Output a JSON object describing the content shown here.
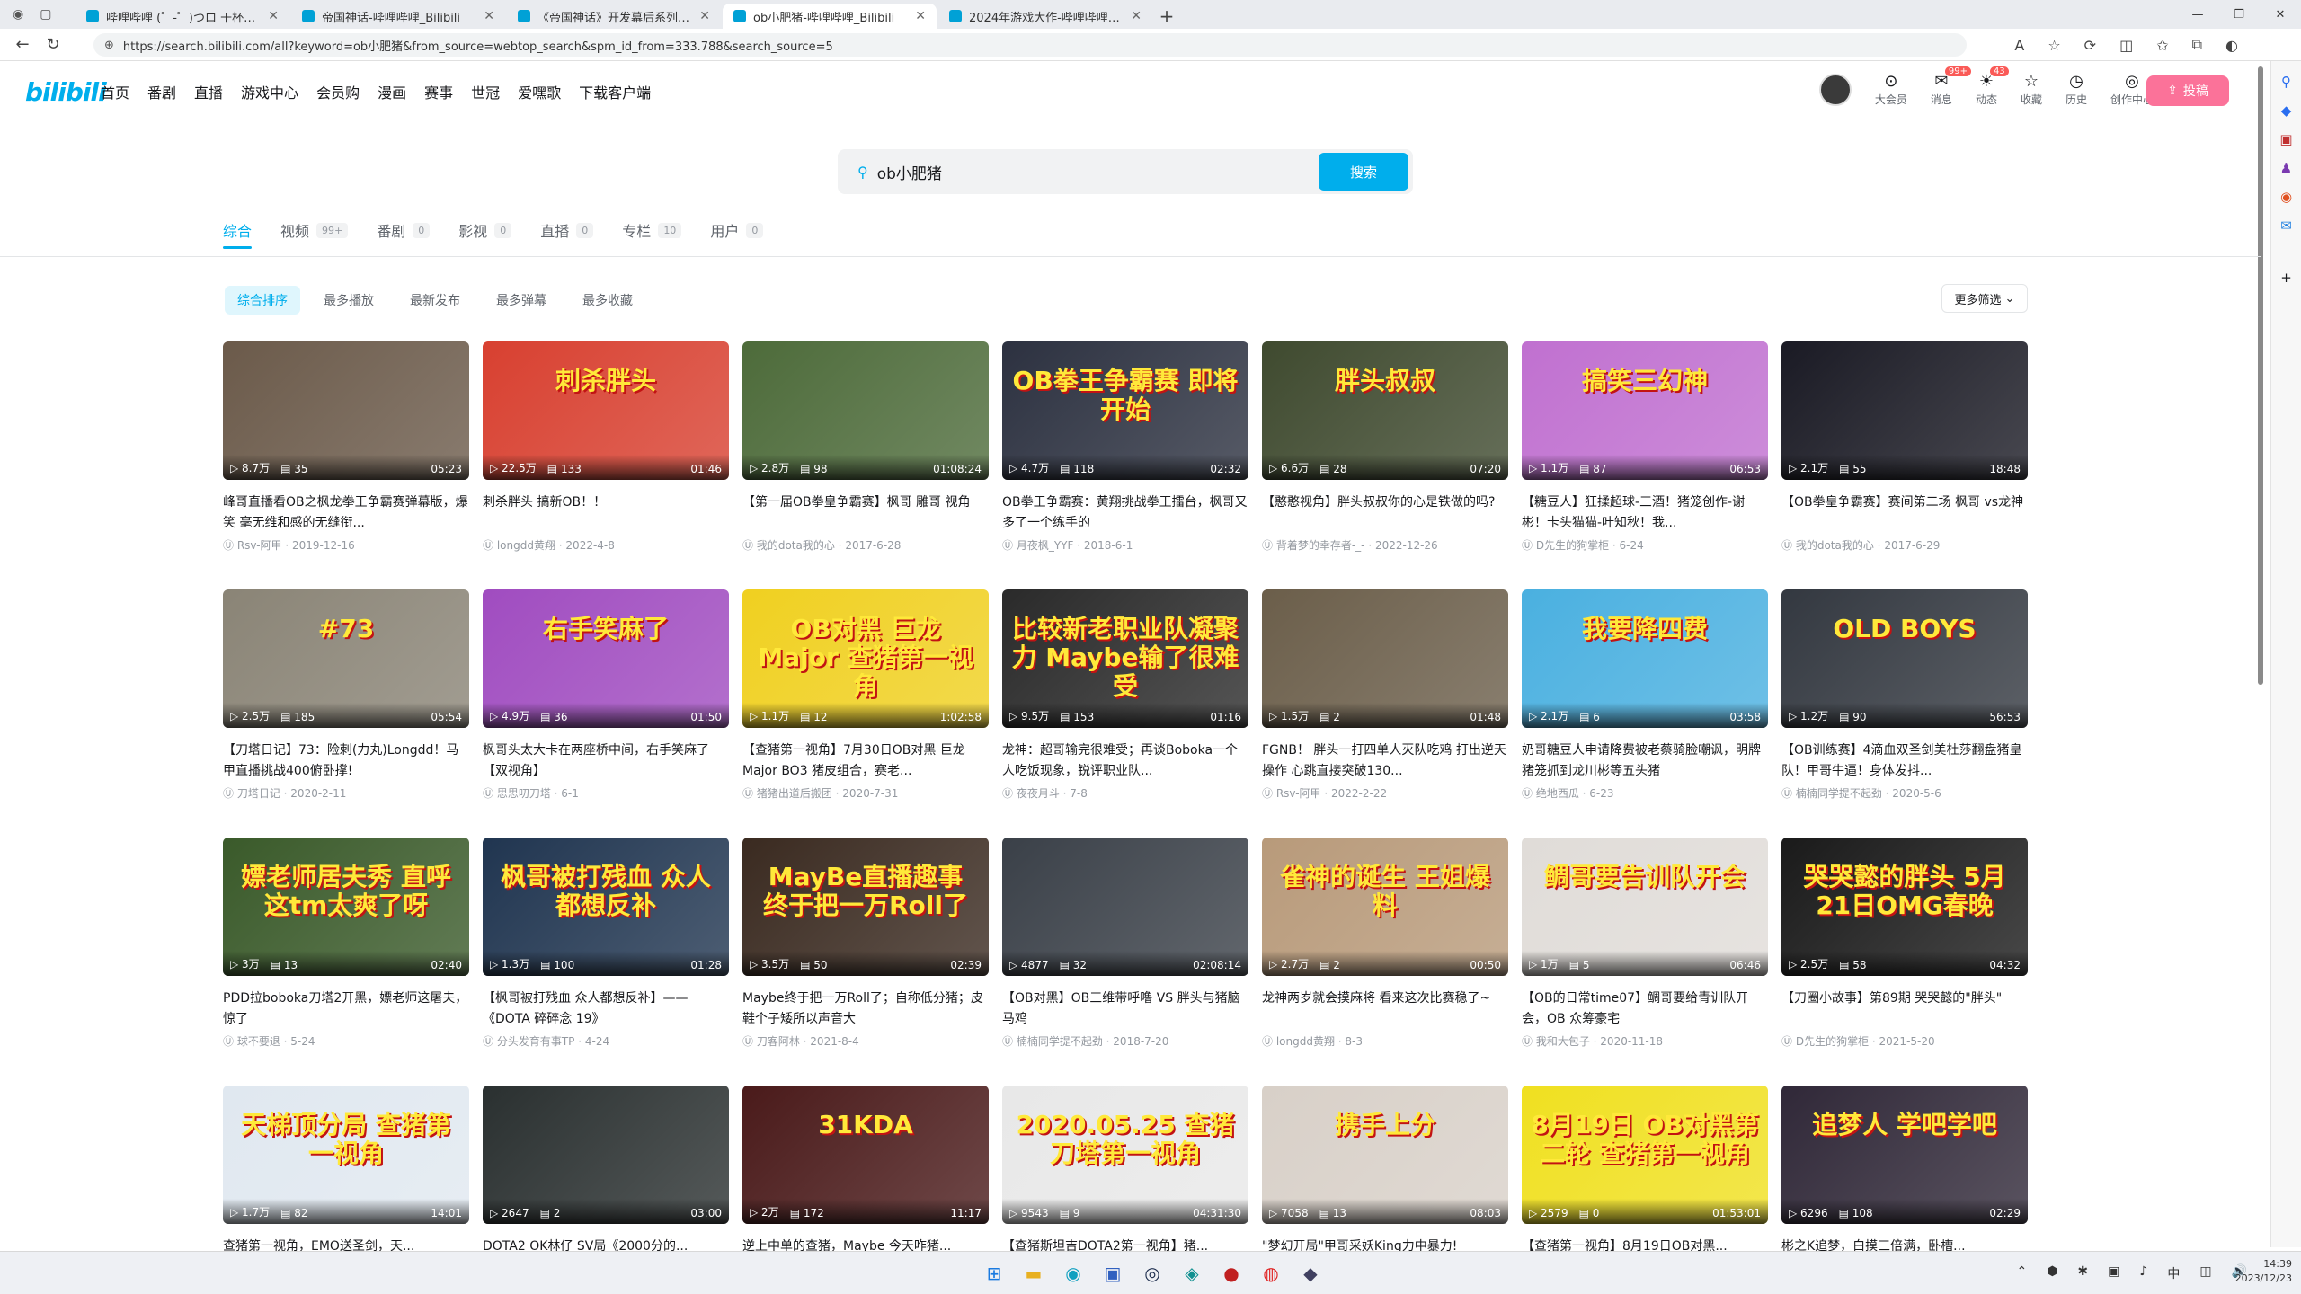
{
  "browser": {
    "tabs": [
      {
        "title": "哔哩哔哩 (゜-゜)つロ 干杯~-bilibili",
        "active": false
      },
      {
        "title": "帝国神话-哔哩哔哩_Bilibili",
        "active": false
      },
      {
        "title": "《帝国神话》开发幕后系列纪录...",
        "active": false
      },
      {
        "title": "ob小肥猪-哔哩哔哩_Bilibili",
        "active": true
      },
      {
        "title": "2024年游戏大作-哔哩哔哩_Bilibili",
        "active": false
      }
    ],
    "url": "https://search.bilibili.com/all?keyword=ob小肥猪&from_source=webtop_search&spm_id_from=333.788&search_source=5"
  },
  "header": {
    "logo": "bilibili",
    "nav": [
      "首页",
      "番剧",
      "直播",
      "游戏中心",
      "会员购",
      "漫画",
      "赛事",
      "世冠",
      "爱嘿歌",
      "下载客户端"
    ],
    "icons": [
      {
        "label": "大会员",
        "icon": "⊙"
      },
      {
        "label": "消息",
        "icon": "✉",
        "badge": "99+"
      },
      {
        "label": "动态",
        "icon": "☀",
        "badge": "43"
      },
      {
        "label": "收藏",
        "icon": "☆"
      },
      {
        "label": "历史",
        "icon": "◷"
      },
      {
        "label": "创作中心",
        "icon": "◎"
      }
    ],
    "upload": "投稿"
  },
  "search": {
    "query": "ob小肥猪",
    "button": "搜索"
  },
  "tabs": [
    {
      "label": "综合",
      "count": ""
    },
    {
      "label": "视频",
      "count": "99+"
    },
    {
      "label": "番剧",
      "count": "0"
    },
    {
      "label": "影视",
      "count": "0"
    },
    {
      "label": "直播",
      "count": "0"
    },
    {
      "label": "专栏",
      "count": "10"
    },
    {
      "label": "用户",
      "count": "0"
    }
  ],
  "sorts": [
    "综合排序",
    "最多播放",
    "最新发布",
    "最多弹幕",
    "最多收藏"
  ],
  "filter": "更多筛选",
  "videos": [
    {
      "thumb_text": "",
      "bg": "#6b5a4a",
      "views": "8.7万",
      "danmaku": "35",
      "dur": "05:23",
      "title": "峰哥直播看OB之枫龙拳王争霸赛弹幕版，爆笑 毫无维和感的无缝衔...",
      "author": "Rsv-阿甲",
      "date": "2019-12-16"
    },
    {
      "thumb_text": "刺杀胖头",
      "bg": "#d84030",
      "views": "22.5万",
      "danmaku": "133",
      "dur": "01:46",
      "title": "刺杀胖头 搞新OB！！",
      "author": "longdd黄翔",
      "date": "2022-4-8"
    },
    {
      "thumb_text": "",
      "bg": "#4d6b3a",
      "views": "2.8万",
      "danmaku": "98",
      "dur": "01:08:24",
      "title": "【第一届OB拳皇争霸赛】枫哥 雕哥 视角",
      "author": "我的dota我的心",
      "date": "2017-6-28"
    },
    {
      "thumb_text": "OB拳王争霸赛 即将开始",
      "bg": "#2c3140",
      "views": "4.7万",
      "danmaku": "118",
      "dur": "02:32",
      "title": "OB拳王争霸赛：黄翔挑战拳王擂台，枫哥又多了一个练手的",
      "author": "月夜枫_YYF",
      "date": "2018-6-1"
    },
    {
      "thumb_text": "胖头叔叔",
      "bg": "#3f4a2f",
      "views": "6.6万",
      "danmaku": "28",
      "dur": "07:20",
      "title": "【憨憨视角】胖头叔叔你的心是铁做的吗?",
      "author": "背着梦的幸存者-_-",
      "date": "2022-12-26"
    },
    {
      "thumb_text": "搞笑三幻神",
      "bg": "#c070d0",
      "views": "1.1万",
      "danmaku": "87",
      "dur": "06:53",
      "title": "【糖豆人】狂揉超球-三酒！猪笼创作-谢彬！卡头猫猫-叶知秋！我...",
      "author": "D先生的狗掌柜",
      "date": "6-24"
    },
    {
      "thumb_text": "",
      "bg": "#1a1a24",
      "views": "2.1万",
      "danmaku": "55",
      "dur": "18:48",
      "title": "【OB拳皇争霸赛】赛间第二场 枫哥 vs龙神",
      "author": "我的dota我的心",
      "date": "2017-6-29"
    },
    {
      "thumb_text": "#73",
      "bg": "#8a8476",
      "views": "2.5万",
      "danmaku": "185",
      "dur": "05:54",
      "title": "【刀塔日记】73：险刺(力丸)Longdd！马甲直播挑战400俯卧撑!",
      "author": "刀塔日记",
      "date": "2020-2-11"
    },
    {
      "thumb_text": "右手笑麻了",
      "bg": "#a04cc0",
      "views": "4.9万",
      "danmaku": "36",
      "dur": "01:50",
      "title": "枫哥头太大卡在两座桥中间，右手笑麻了【双视角】",
      "author": "思思叨刀塔",
      "date": "6-1"
    },
    {
      "thumb_text": "OB对黑 巨龙Major 查猪第一视角",
      "bg": "#f0d020",
      "views": "1.1万",
      "danmaku": "12",
      "dur": "1:02:58",
      "title": "【查猪第一视角】7月30日OB对黑 巨龙Major BO3 猪皮组合，赛老...",
      "author": "猪猪出道后搬团",
      "date": "2020-7-31"
    },
    {
      "thumb_text": "比较新老职业队凝聚力 Maybe输了很难受",
      "bg": "#2a2a2a",
      "views": "9.5万",
      "danmaku": "153",
      "dur": "01:16",
      "title": "龙神：超哥输完很难受；再谈Boboka一个人吃饭现象，锐评职业队...",
      "author": "夜夜月斗",
      "date": "7-8"
    },
    {
      "thumb_text": "",
      "bg": "#6b5e4a",
      "views": "1.5万",
      "danmaku": "2",
      "dur": "01:48",
      "title": "FGNB！ 胖头一打四单人灭队吃鸡 打出逆天操作 心跳直接突破130...",
      "author": "Rsv-阿甲",
      "date": "2022-2-22"
    },
    {
      "thumb_text": "我要降四费",
      "bg": "#4ab0e0",
      "views": "2.1万",
      "danmaku": "6",
      "dur": "03:58",
      "title": "奶哥糖豆人申请降费被老蔡骑脸嘲讽，明牌猪笼抓到龙川彬等五头猪",
      "author": "绝地西瓜",
      "date": "6-23"
    },
    {
      "thumb_text": "OLD BOYS",
      "bg": "#333840",
      "views": "1.2万",
      "danmaku": "90",
      "dur": "56:53",
      "title": "【OB训练赛】4滴血双圣剑美杜莎翻盘猪皇队！甲哥牛逼！身体发抖...",
      "author": "楠楠同学提不起劲",
      "date": "2020-5-6"
    },
    {
      "thumb_text": "嫖老师居夫秀 直呼这tm太爽了呀",
      "bg": "#3a5a2a",
      "views": "3万",
      "danmaku": "13",
      "dur": "02:40",
      "title": "PDD拉boboka刀塔2开黑，嫖老师这屠夫，惊了",
      "author": "球不要退",
      "date": "5-24"
    },
    {
      "thumb_text": "枫哥被打残血 众人都想反补",
      "bg": "#203550",
      "views": "1.3万",
      "danmaku": "100",
      "dur": "01:28",
      "title": "【枫哥被打残血 众人都想反补】——《DOTA 碎碎念 19》",
      "author": "分头发育有事TP",
      "date": "4-24"
    },
    {
      "thumb_text": "MayBe直播趣事 终于把一万Roll了",
      "bg": "#3a2a20",
      "views": "3.5万",
      "danmaku": "50",
      "dur": "02:39",
      "title": "Maybe终于把一万Roll了；自称低分猪；皮鞋个子矮所以声音大",
      "author": "刀客阿林",
      "date": "2021-8-4"
    },
    {
      "thumb_text": "",
      "bg": "#3a4048",
      "views": "4877",
      "danmaku": "32",
      "dur": "02:08:14",
      "title": "【OB对黑】OB三维带呼噜 VS 胖头与猪脑马鸡",
      "author": "楠楠同学提不起劲",
      "date": "2018-7-20"
    },
    {
      "thumb_text": "雀神的诞生 王姐爆料",
      "bg": "#b89a7a",
      "views": "2.7万",
      "danmaku": "2",
      "dur": "00:50",
      "title": "龙神两岁就会摸麻将 看来这次比赛稳了~",
      "author": "longdd黄翔",
      "date": "8-3"
    },
    {
      "thumb_text": "鲷哥要告训队开会",
      "bg": "#e0dcd8",
      "views": "1万",
      "danmaku": "5",
      "dur": "06:46",
      "title": "【OB的日常time07】鲷哥要给青训队开会，OB 众筹豪宅",
      "author": "我和大包子",
      "date": "2020-11-18"
    },
    {
      "thumb_text": "哭哭懿的胖头 5月21日OMG春晚",
      "bg": "#1a1a1a",
      "views": "2.5万",
      "danmaku": "58",
      "dur": "04:32",
      "title": "【刀圈小故事】第89期 哭哭懿的\"胖头\"",
      "author": "D先生的狗掌柜",
      "date": "2021-5-20"
    },
    {
      "thumb_text": "天梯顶分局 查猪第一视角",
      "bg": "#e0e8f0",
      "views": "1.7万",
      "danmaku": "82",
      "dur": "14:01",
      "title": "查猪第一视角，EMO送圣剑，天...",
      "author": "",
      "date": ""
    },
    {
      "thumb_text": "",
      "bg": "#2a3030",
      "views": "2647",
      "danmaku": "2",
      "dur": "03:00",
      "title": "DOTA2 OK林仔 SV局《2000分的...",
      "author": "",
      "date": ""
    },
    {
      "thumb_text": "31KDA",
      "bg": "#4a1a1a",
      "views": "2万",
      "danmaku": "172",
      "dur": "11:17",
      "title": "逆上中单的查猪，Maybe 今天咋猪...",
      "author": "",
      "date": ""
    },
    {
      "thumb_text": "2020.05.25 查猪刀塔第一视角",
      "bg": "#e8e8e8",
      "views": "9543",
      "danmaku": "9",
      "dur": "04:31:30",
      "title": "【查猪斯坦吉DOTA2第一视角】猪...",
      "author": "",
      "date": ""
    },
    {
      "thumb_text": "携手上分",
      "bg": "#d8d0c8",
      "views": "7058",
      "danmaku": "13",
      "dur": "08:03",
      "title": "\"梦幻开局\"甲哥采妖King力中暴力!",
      "author": "",
      "date": ""
    },
    {
      "thumb_text": "8月19日 OB对黑第二轮 查猪第一视角",
      "bg": "#f0e020",
      "views": "2579",
      "danmaku": "0",
      "dur": "01:53:01",
      "title": "【查猪第一视角】8月19日OB对黑...",
      "author": "",
      "date": ""
    },
    {
      "thumb_text": "追梦人 学吧学吧",
      "bg": "#302838",
      "views": "6296",
      "danmaku": "108",
      "dur": "02:29",
      "title": "彬之K追梦，白摸三倍满，卧槽...",
      "author": "",
      "date": ""
    }
  ],
  "taskbar": {
    "time": "14:39",
    "date": "2023/12/23",
    "tray": [
      "⌃",
      "⬢",
      "✱",
      "▣",
      "♪",
      "中",
      "◫",
      "🔊"
    ]
  }
}
